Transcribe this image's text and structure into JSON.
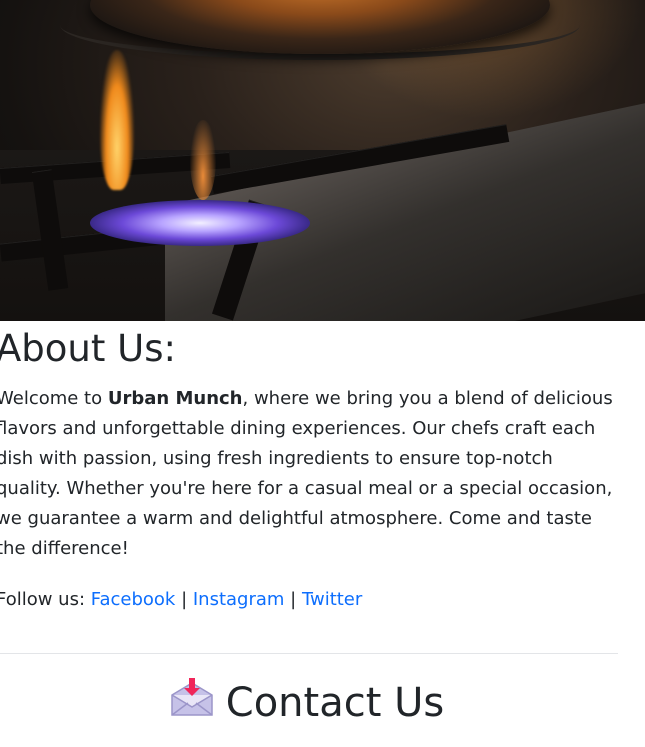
{
  "about": {
    "title": "About Us:",
    "intro": "Welcome to ",
    "brand": "Urban Munch",
    "body": ", where we bring you a blend of delicious flavors and unforgettable dining experiences. Our chefs craft each dish with passion, using fresh ingredients to ensure top-notch quality. Whether you're here for a casual meal or a special occasion, we guarantee a warm and delightful atmosphere. Come and taste the difference!"
  },
  "follow": {
    "label": "Follow us: ",
    "separator": " | ",
    "links": [
      {
        "label": "Facebook"
      },
      {
        "label": "Instagram"
      },
      {
        "label": "Twitter"
      }
    ]
  },
  "contact": {
    "title": "Contact Us",
    "icon": "incoming-envelope-icon"
  },
  "colors": {
    "link": "#0d6efd",
    "text": "#212529"
  }
}
